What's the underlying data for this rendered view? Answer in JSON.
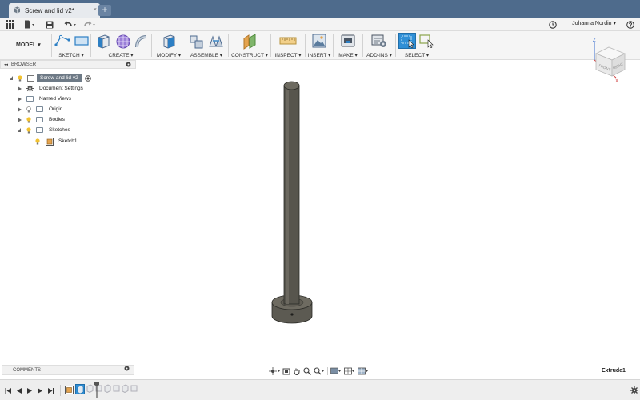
{
  "colors": {
    "title_bar": "#4e6b8c",
    "select_highlight": "#2f8fd6",
    "body_fill": "#5e5b52"
  },
  "title_bar": {
    "tab_label": "Screw and lid v2*",
    "tab_close": "×",
    "new_tab": "+"
  },
  "quick_access": {
    "icons": [
      "apps-grid-icon",
      "file-icon",
      "save-icon",
      "undo-icon",
      "redo-icon"
    ],
    "user_name": "Johanna Nordin ▾",
    "history_icon": "clock-icon",
    "help_icon": "help-icon"
  },
  "toolbar": {
    "workspace": "MODEL ▾",
    "groups": [
      {
        "label": "SKETCH ▾"
      },
      {
        "label": "CREATE ▾"
      },
      {
        "label": "MODIFY ▾"
      },
      {
        "label": "ASSEMBLE ▾"
      },
      {
        "label": "CONSTRUCT ▾"
      },
      {
        "label": "INSPECT ▾"
      },
      {
        "label": "INSERT ▾"
      },
      {
        "label": "MAKE ▾"
      },
      {
        "label": "ADD-INS ▾"
      },
      {
        "label": "SELECT ▾"
      }
    ]
  },
  "browser": {
    "header": "BROWSER",
    "collapse_glyph": "◂◂",
    "items": [
      {
        "label": "Screw and lid v2"
      },
      {
        "label": "Document Settings"
      },
      {
        "label": "Named Views"
      },
      {
        "label": "Origin"
      },
      {
        "label": "Bodies"
      },
      {
        "label": "Sketches"
      },
      {
        "label": "Sketch1"
      }
    ]
  },
  "viewcube": {
    "axis_z": "Z",
    "axis_x": "X",
    "face_front": "FRONT",
    "face_right": "RIGHT"
  },
  "comments": {
    "header": "COMMENTS"
  },
  "status": {
    "text": "Extrude1"
  }
}
